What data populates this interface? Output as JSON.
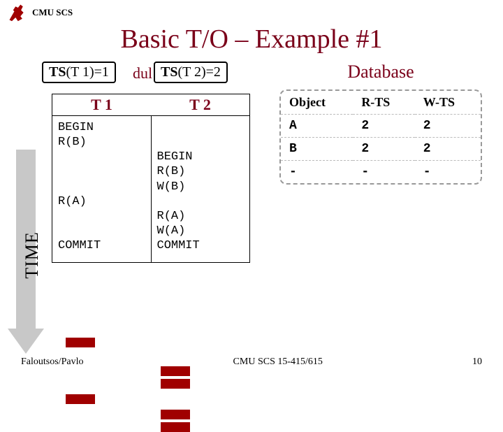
{
  "header": {
    "course": "CMU SCS"
  },
  "title": "Basic T/O – Example #1",
  "schedule": {
    "hidden_label": "dul",
    "ts1": {
      "label": "TS",
      "arg": "(T 1)=1"
    },
    "ts2": {
      "label": "TS",
      "arg": "(T 2)=2"
    },
    "col1_head": "T 1",
    "col2_head": "T 2",
    "t1_ops": [
      "BEGIN",
      "R(B)",
      "",
      "",
      "",
      "R(A)",
      "",
      "",
      "COMMIT"
    ],
    "t2_ops": [
      "",
      "",
      "BEGIN",
      "R(B)",
      "W(B)",
      "",
      "R(A)",
      "W(A)",
      "COMMIT"
    ]
  },
  "time_label": "TIME",
  "database": {
    "title": "Database",
    "headers": [
      "Object",
      "R-TS",
      "W-TS"
    ],
    "rows": [
      [
        "A",
        "2",
        "2"
      ],
      [
        "B",
        "2",
        "2"
      ],
      [
        "-",
        "-",
        "-"
      ]
    ]
  },
  "footer": {
    "left": "Faloutsos/Pavlo",
    "center": "CMU SCS 15-415/615",
    "right": "10"
  }
}
